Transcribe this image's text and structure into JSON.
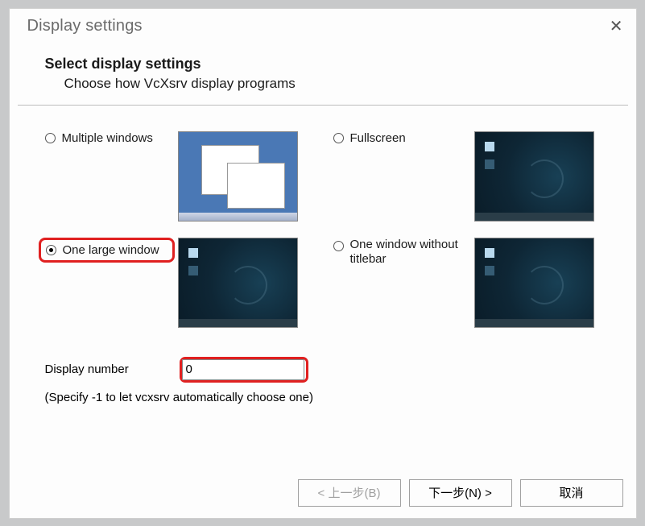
{
  "title": "Display settings",
  "header": {
    "main": "Select display settings",
    "sub": "Choose how VcXsrv display programs"
  },
  "options": {
    "multiple": {
      "label": "Multiple windows",
      "selected": false
    },
    "fullscreen": {
      "label": "Fullscreen",
      "selected": false
    },
    "onelarge": {
      "label": "One large window",
      "selected": true
    },
    "notitle": {
      "label": "One window without titlebar",
      "selected": false
    }
  },
  "display_number": {
    "label": "Display number",
    "value": "0"
  },
  "hint": "(Specify -1 to let vcxsrv automatically choose one)",
  "buttons": {
    "back": "< 上一步(B)",
    "next": "下一步(N) >",
    "cancel": "取消"
  }
}
